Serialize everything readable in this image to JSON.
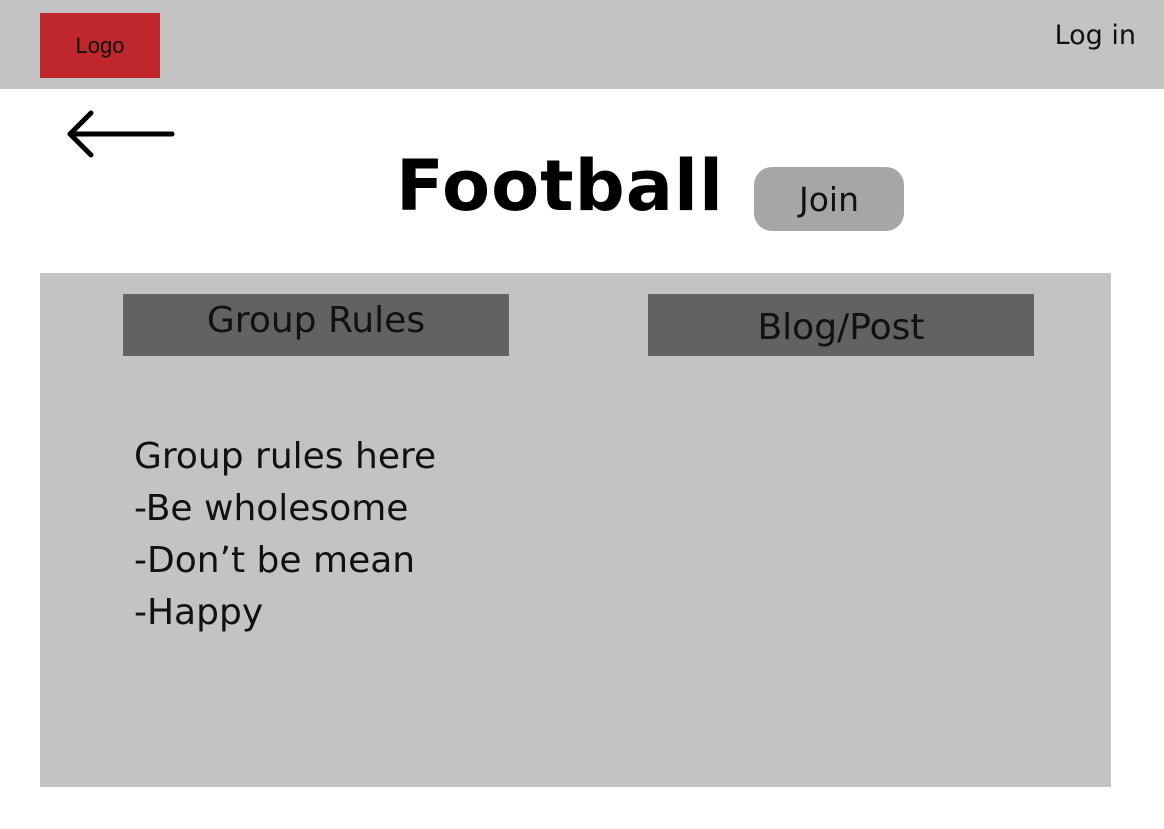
{
  "header": {
    "logo_label": "Logo",
    "login_label": "Log in"
  },
  "page": {
    "title": "Football",
    "join_label": "Join"
  },
  "tabs": {
    "rules_label": "Group Rules",
    "blog_label": "Blog/Post"
  },
  "rules": {
    "lines": [
      "Group rules here",
      "-Be wholesome",
      "-Don’t be mean",
      "-Happy"
    ]
  },
  "colors": {
    "logo_bg": "#c0272d",
    "header_bg": "#c3c3c3",
    "panel_bg": "#c3c3c3",
    "tab_bg": "#626262",
    "join_bg": "#a6a6a6"
  },
  "icons": {
    "back": "arrow-left-icon"
  }
}
